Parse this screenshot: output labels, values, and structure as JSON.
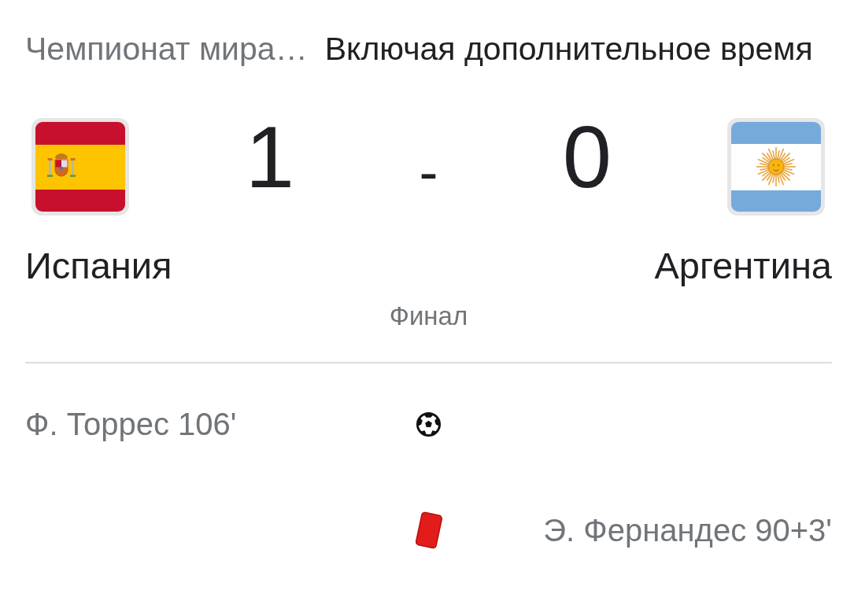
{
  "header": {
    "competition": "Чемпионат мира…",
    "note": "Включая дополнительное время"
  },
  "teams": [
    {
      "name": "Испания",
      "score": "1"
    },
    {
      "name": "Аргентина",
      "score": "0"
    }
  ],
  "score_separator": "-",
  "status": "Финал",
  "events": [
    {
      "kind": "goal",
      "home": "Ф. Торрес 106'"
    },
    {
      "kind": "red_card",
      "away": "Э. Фернандес 90+3'"
    }
  ]
}
